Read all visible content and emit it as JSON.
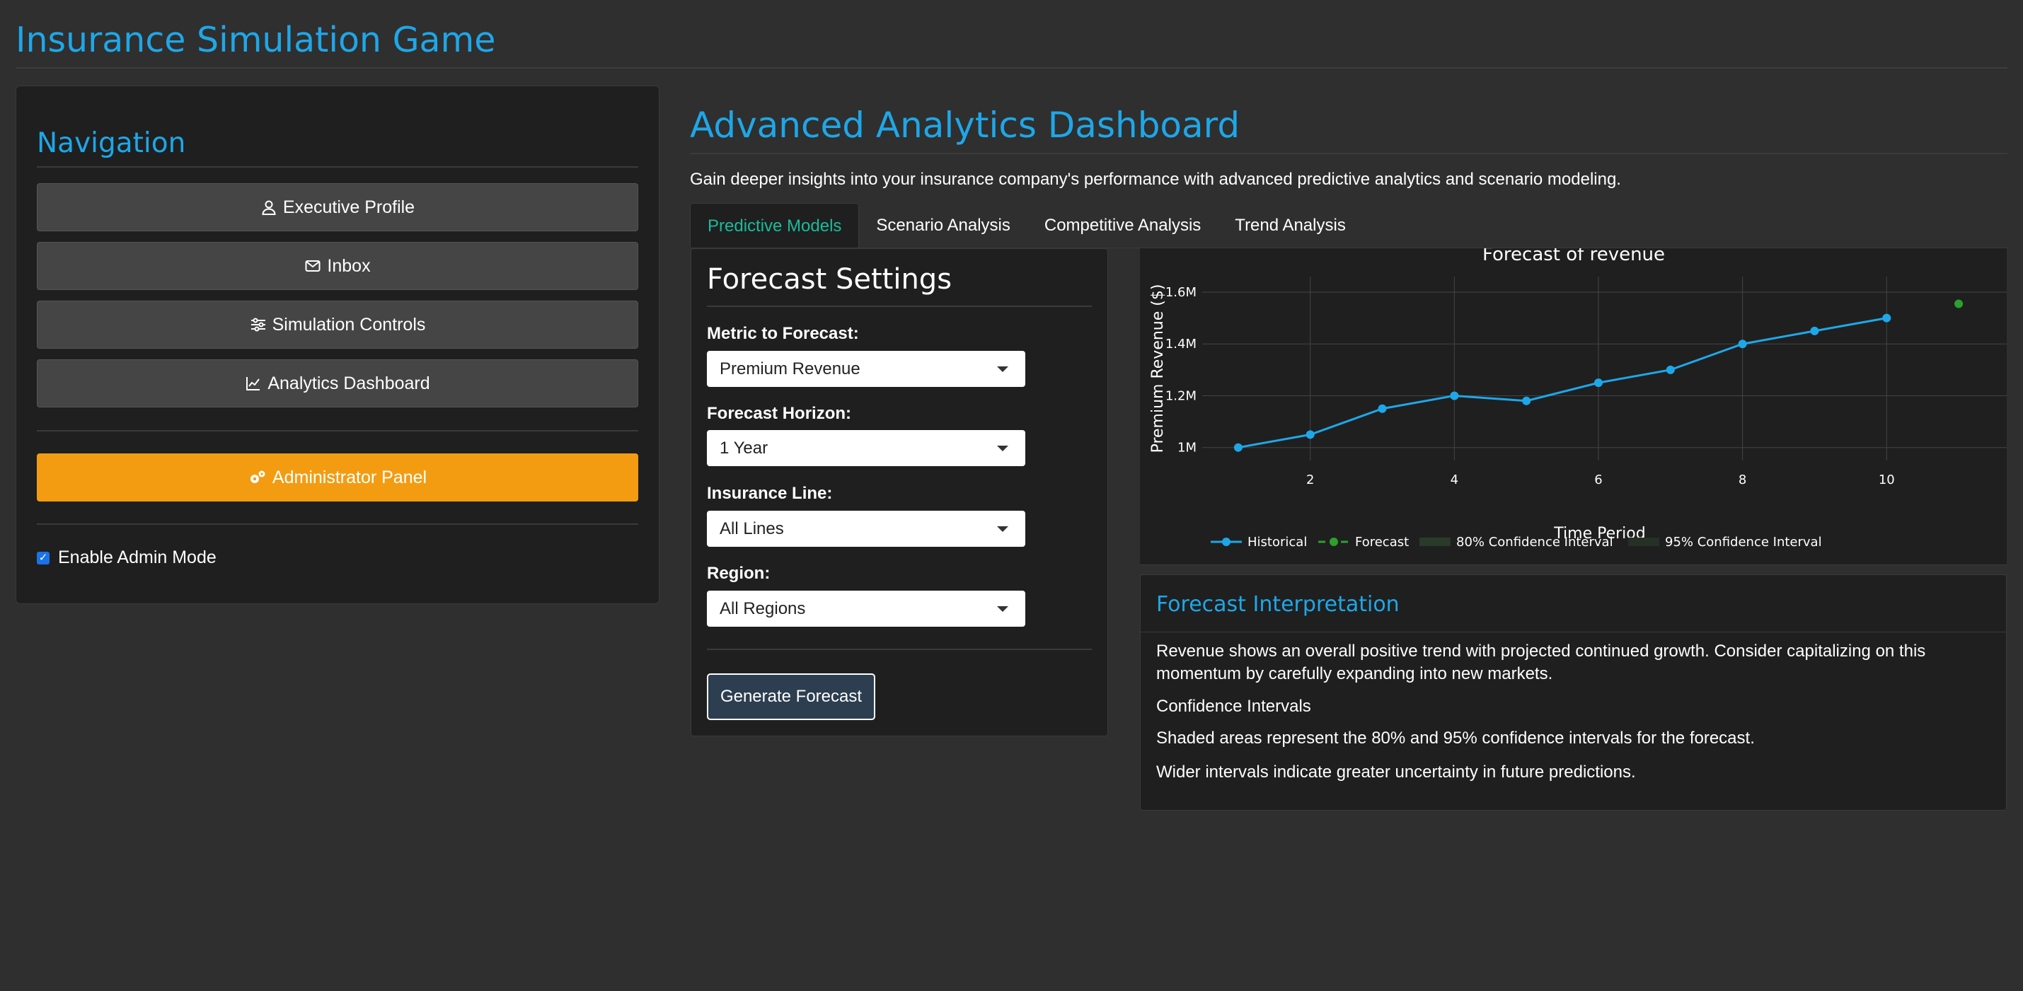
{
  "app": {
    "title": "Insurance Simulation Game"
  },
  "sidebar": {
    "title": "Navigation",
    "items": [
      {
        "label": "Executive Profile",
        "icon": "user-icon"
      },
      {
        "label": "Inbox",
        "icon": "envelope-icon"
      },
      {
        "label": "Simulation Controls",
        "icon": "sliders-icon"
      },
      {
        "label": "Analytics Dashboard",
        "icon": "line-chart-icon"
      }
    ],
    "admin_button": {
      "label": "Administrator Panel",
      "icon": "gears-icon",
      "color": "#f39c12"
    },
    "admin_mode": {
      "label": "Enable Admin Mode",
      "checked": true
    }
  },
  "main": {
    "title": "Advanced Analytics Dashboard",
    "description": "Gain deeper insights into your insurance company's performance with advanced predictive analytics and scenario modeling.",
    "tabs": [
      {
        "label": "Predictive Models",
        "active": true
      },
      {
        "label": "Scenario Analysis",
        "active": false
      },
      {
        "label": "Competitive Analysis",
        "active": false
      },
      {
        "label": "Trend Analysis",
        "active": false
      }
    ]
  },
  "settings": {
    "title": "Forecast Settings",
    "fields": [
      {
        "label": "Metric to Forecast:",
        "value": "Premium Revenue"
      },
      {
        "label": "Forecast Horizon:",
        "value": "1 Year"
      },
      {
        "label": "Insurance Line:",
        "value": "All Lines"
      },
      {
        "label": "Region:",
        "value": "All Regions"
      }
    ],
    "generate_label": "Generate Forecast"
  },
  "chart_data": {
    "type": "line",
    "title": "Forecast of revenue",
    "xlabel": "Time Period",
    "ylabel": "Premium Revenue ($)",
    "xlim": [
      0.5,
      11.5
    ],
    "ylim": [
      950000,
      1660000
    ],
    "x_ticks": [
      2,
      4,
      6,
      8,
      10
    ],
    "y_ticks": [
      {
        "value": 1000000,
        "label": "1M"
      },
      {
        "value": 1200000,
        "label": "1.2M"
      },
      {
        "value": 1400000,
        "label": "1.4M"
      },
      {
        "value": 1600000,
        "label": "1.6M"
      }
    ],
    "grid": true,
    "legend_position": "bottom",
    "series": [
      {
        "name": "Historical",
        "color": "#1ea7e8",
        "mode": "lines+markers",
        "x": [
          1,
          2,
          3,
          4,
          5,
          6,
          7,
          8,
          9,
          10
        ],
        "y": [
          1000000,
          1050000,
          1150000,
          1200000,
          1180000,
          1250000,
          1300000,
          1400000,
          1450000,
          1500000
        ]
      },
      {
        "name": "Forecast",
        "color": "#2ca02c",
        "mode": "lines+markers",
        "x": [
          11
        ],
        "y": [
          1555000
        ]
      },
      {
        "name": "80% Confidence Interval",
        "color": "#2a3a2a",
        "mode": "fill"
      },
      {
        "name": "95% Confidence Interval",
        "color": "#263026",
        "mode": "fill"
      }
    ]
  },
  "interpretation": {
    "title": "Forecast Interpretation",
    "summary": "Revenue shows an overall positive trend with projected continued growth. Consider capitalizing on this momentum by carefully expanding into new markets.",
    "ci_heading": "Confidence Intervals",
    "ci_text1": "Shaded areas represent the 80% and 95% confidence intervals for the forecast.",
    "ci_text2": "Wider intervals indicate greater uncertainty in future predictions."
  }
}
